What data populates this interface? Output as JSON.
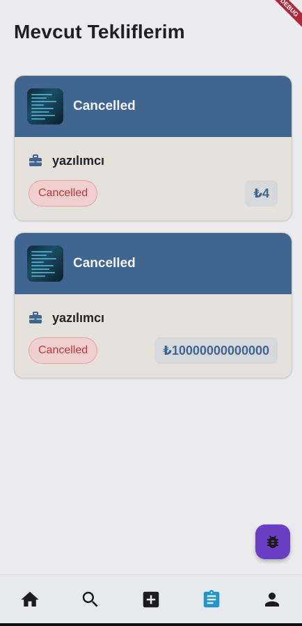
{
  "debug_banner": "DEBUG",
  "page_title": "Mevcut Tekliflerim",
  "offers": [
    {
      "header_title": "Cancelled",
      "role": "yazılımcı",
      "status": "Cancelled",
      "price": "₺4"
    },
    {
      "header_title": "Cancelled",
      "role": "yazılımcı",
      "status": "Cancelled",
      "price": "₺10000000000000"
    }
  ],
  "fab": {
    "icon": "bug-icon"
  },
  "bottom_nav": {
    "items": [
      {
        "icon": "home-icon",
        "active": false
      },
      {
        "icon": "search-icon",
        "active": false
      },
      {
        "icon": "add-box-icon",
        "active": false
      },
      {
        "icon": "assignment-icon",
        "active": true
      },
      {
        "icon": "person-icon",
        "active": false
      }
    ]
  },
  "colors": {
    "background": "#ebebed",
    "card_header": "#3f6590",
    "card_body": "#e5e2db",
    "status_red": "#c0343e",
    "fab": "#6a3dc3",
    "nav_active": "#2196c9",
    "nav_inactive": "#1c1c1f"
  }
}
